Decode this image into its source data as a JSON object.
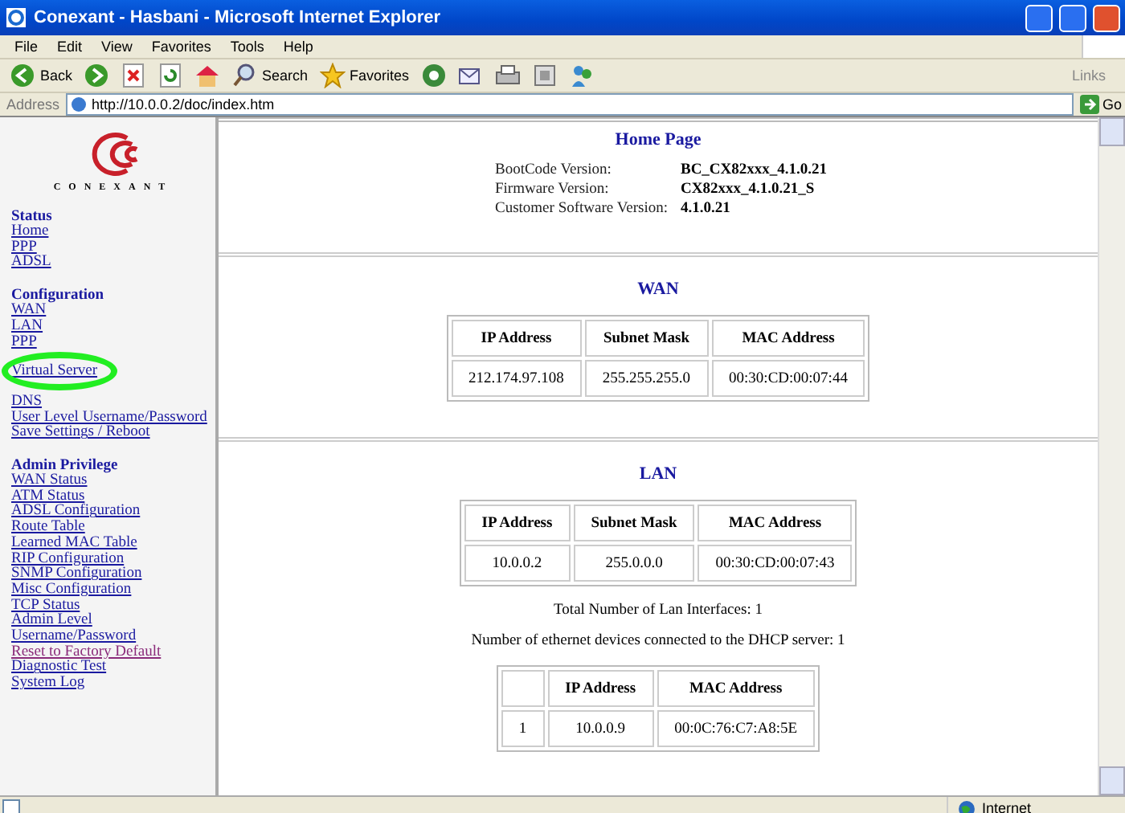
{
  "window": {
    "title": "Conexant - Hasbani - Microsoft Internet Explorer"
  },
  "menu_bar": [
    "File",
    "Edit",
    "View",
    "Favorites",
    "Tools",
    "Help"
  ],
  "toolbar": [
    {
      "kind": "back",
      "label": "Back"
    },
    {
      "kind": "forward"
    },
    {
      "kind": "stop"
    },
    {
      "kind": "refresh"
    },
    {
      "kind": "home"
    },
    {
      "kind": "search",
      "label": "Search"
    },
    {
      "kind": "favorites",
      "label": "Favorites"
    },
    {
      "kind": "media"
    },
    {
      "kind": "mail"
    },
    {
      "kind": "print"
    },
    {
      "kind": "edit"
    },
    {
      "kind": "messenger"
    }
  ],
  "links_label": "Links",
  "address_bar": {
    "label": "Address",
    "url": "http://10.0.0.2/doc/index.htm",
    "go": "Go"
  },
  "sidebar": {
    "logo_text": "CONEXANT",
    "sections": [
      {
        "heading": "Status",
        "items": [
          {
            "label": "Home",
            "visited": false
          },
          {
            "label": "PPP",
            "visited": false
          },
          {
            "label": "ADSL",
            "visited": false
          }
        ]
      },
      {
        "heading": "Configuration",
        "items": [
          {
            "label": "WAN",
            "visited": false
          },
          {
            "label": "LAN",
            "visited": false
          },
          {
            "label": "PPP",
            "visited": false
          },
          {
            "label": "Virtual Server",
            "visited": false,
            "circled": true
          },
          {
            "label": "DNS",
            "visited": false
          },
          {
            "label": "User Level Username/Password",
            "visited": false
          },
          {
            "label": "Save Settings / Reboot",
            "visited": false
          }
        ]
      },
      {
        "heading": "Admin Privilege",
        "items": [
          {
            "label": "WAN Status",
            "visited": false
          },
          {
            "label": "ATM Status",
            "visited": false
          },
          {
            "label": "ADSL Configuration",
            "visited": false
          },
          {
            "label": "Route Table",
            "visited": false
          },
          {
            "label": "Learned MAC Table",
            "visited": false
          },
          {
            "label": "RIP Configuration",
            "visited": false
          },
          {
            "label": "SNMP Configuration",
            "visited": false
          },
          {
            "label": "Misc Configuration",
            "visited": false
          },
          {
            "label": "TCP Status",
            "visited": false
          },
          {
            "label": "Admin Level",
            "visited": false
          },
          {
            "label": "Username/Password",
            "visited": false
          },
          {
            "label": "Reset to Factory Default",
            "visited": true
          },
          {
            "label": "Diagnostic Test",
            "visited": false
          },
          {
            "label": "System Log",
            "visited": false
          }
        ]
      }
    ]
  },
  "main": {
    "title": "Home Page",
    "versions": [
      {
        "label": "BootCode Version:",
        "value": "BC_CX82xxx_4.1.0.21"
      },
      {
        "label": "Firmware Version:",
        "value": "CX82xxx_4.1.0.21_S"
      },
      {
        "label": "Customer Software Version:",
        "value": "4.1.0.21"
      }
    ],
    "wan": {
      "title": "WAN",
      "columns": [
        "IP Address",
        "Subnet Mask",
        "MAC Address"
      ],
      "rows": [
        [
          "212.174.97.108",
          "255.255.255.0",
          "00:30:CD:00:07:44"
        ]
      ]
    },
    "lan": {
      "title": "LAN",
      "columns": [
        "IP Address",
        "Subnet Mask",
        "MAC Address"
      ],
      "rows": [
        [
          "10.0.0.2",
          "255.0.0.0",
          "00:30:CD:00:07:43"
        ]
      ]
    },
    "notes": [
      "Total Number of Lan Interfaces: 1",
      "Number of ethernet devices connected to the DHCP server: 1"
    ],
    "dhcp_table": {
      "columns": [
        "",
        "IP Address",
        "MAC Address"
      ],
      "rows": [
        [
          "1",
          "10.0.0.9",
          "00:0C:76:C7:A8:5E"
        ]
      ]
    }
  },
  "status_bar": {
    "zone": "Internet"
  }
}
